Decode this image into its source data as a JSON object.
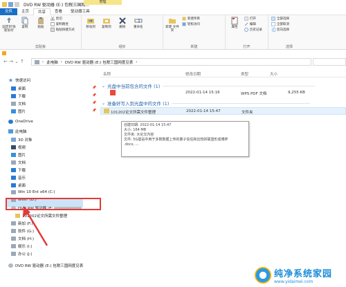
{
  "window": {
    "title": "DVD RW 驱动器 (E:) 包税三国网..."
  },
  "ribbon_context_tab": "管理",
  "tabs": [
    "文件",
    "主页",
    "共享",
    "查看",
    "驱动器工具"
  ],
  "ribbon": {
    "clipboard": {
      "label": "剪贴板",
      "pin": "固定到'快速访问'",
      "copy": "复制",
      "paste": "粘贴",
      "cut": "剪切",
      "copy_path": "复制路径",
      "paste_shortcut": "粘贴快捷方式"
    },
    "organize": {
      "label": "组织",
      "move_to": "移动到",
      "copy_to": "复制到",
      "delete": "删除",
      "rename": "重命名"
    },
    "new": {
      "label": "新建",
      "new_folder": "新建\n文件夹",
      "new_item": "新建项目",
      "easy_access": "轻松访问"
    },
    "open": {
      "label": "打开",
      "properties": "属性",
      "open": "打开",
      "edit": "编辑",
      "history": "历史记录"
    },
    "select": {
      "label": "选择",
      "select_all": "全部选择",
      "select_none": "全部取消",
      "invert": "反向选择"
    }
  },
  "address": {
    "crumbs": [
      "此电脑",
      "DVD RW 驱动器 (E:) 包税三国网度见表"
    ]
  },
  "sidebar": {
    "quick_access": "快速访问",
    "items": [
      {
        "label": "桌面",
        "pinned": true
      },
      {
        "label": "下载",
        "pinned": true
      },
      {
        "label": "文档",
        "pinned": true
      },
      {
        "label": "图片",
        "pinned": true
      }
    ],
    "onedrive": "OneDrive",
    "this_pc": "此电脑",
    "pc_items": [
      "3D 对象",
      "视频",
      "图片",
      "文档",
      "下载",
      "音乐",
      "桌面"
    ],
    "drive_c": "Win 10 Ent x64 (C:)",
    "drive_d": "WIN7 (D:)",
    "drive_e": "DVD RW 驱动器 (E:",
    "drive_e_child": "101202论文所需文件整理",
    "drive_f": "新加 (F:)",
    "drive_g": "软件 (G:)",
    "drive_h": "文档 (H:)",
    "drive_i": "娱乐 (I:)",
    "drive_j": "办公 (J:)",
    "bottom_drive": "DVD RW 驱动器 (E:) 包税三国网度见表"
  },
  "columns": {
    "name": "名称",
    "modified": "修改日期",
    "type": "类型",
    "size": "大小"
  },
  "groups": [
    {
      "title": "光盘中当前包含的文件 (1)"
    },
    {
      "title": "准备好写入到光盘中的文件 (1)"
    }
  ],
  "files_on_disc": [
    {
      "name": "",
      "modified": "2022-01-14 15:16",
      "type": "WPS PDF 文档",
      "size": "9,255 KB"
    }
  ],
  "files_to_write": [
    {
      "name": "101202论文所需文件整理",
      "modified": "2022-01-14 15:47",
      "type": "文件夹",
      "size": ""
    }
  ],
  "tooltip": {
    "line1": "创建日期: 2022-01-14 15:47",
    "line2": "大小: 164 MB",
    "line3": "文件夹: 大论文内容",
    "line4": "文件: 5G基站中用于多数数据上传的量子信任和比较的联盟形成博弈",
    "line5": ".docx, ..."
  },
  "watermark": {
    "title": "纯净系统家园",
    "url": "www.yidaimei.com"
  },
  "colors": {
    "accent": "#1a6ec7",
    "highlight": "#e03a3a",
    "group_text": "#1e5fa8"
  }
}
